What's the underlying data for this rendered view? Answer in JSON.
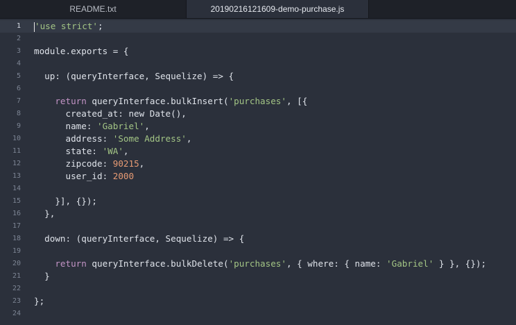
{
  "tabs": [
    {
      "label": "README.txt",
      "active": false
    },
    {
      "label": "20190216121609-demo-purchase.js",
      "active": true
    }
  ],
  "editor": {
    "current_line": 1,
    "lines": [
      {
        "num": "1",
        "tokens": [
          {
            "t": "'use strict'",
            "c": "str"
          },
          {
            "t": ";",
            "c": "plain"
          }
        ]
      },
      {
        "num": "2",
        "tokens": []
      },
      {
        "num": "3",
        "tokens": [
          {
            "t": "module.exports = {",
            "c": "plain"
          }
        ]
      },
      {
        "num": "4",
        "tokens": []
      },
      {
        "num": "5",
        "tokens": [
          {
            "t": "  up: (queryInterface, Sequelize) => {",
            "c": "plain"
          }
        ]
      },
      {
        "num": "6",
        "tokens": []
      },
      {
        "num": "7",
        "tokens": [
          {
            "t": "    ",
            "c": "plain"
          },
          {
            "t": "return",
            "c": "kw"
          },
          {
            "t": " queryInterface.bulkInsert(",
            "c": "plain"
          },
          {
            "t": "'purchases'",
            "c": "str"
          },
          {
            "t": ", [{",
            "c": "plain"
          }
        ]
      },
      {
        "num": "8",
        "tokens": [
          {
            "t": "      created_at: new Date(),",
            "c": "plain"
          }
        ]
      },
      {
        "num": "9",
        "tokens": [
          {
            "t": "      name: ",
            "c": "plain"
          },
          {
            "t": "'Gabriel'",
            "c": "str"
          },
          {
            "t": ",",
            "c": "plain"
          }
        ]
      },
      {
        "num": "10",
        "tokens": [
          {
            "t": "      address: ",
            "c": "plain"
          },
          {
            "t": "'Some Address'",
            "c": "str"
          },
          {
            "t": ",",
            "c": "plain"
          }
        ]
      },
      {
        "num": "11",
        "tokens": [
          {
            "t": "      state: ",
            "c": "plain"
          },
          {
            "t": "'WA'",
            "c": "str"
          },
          {
            "t": ",",
            "c": "plain"
          }
        ]
      },
      {
        "num": "12",
        "tokens": [
          {
            "t": "      zipcode: ",
            "c": "plain"
          },
          {
            "t": "90215",
            "c": "num"
          },
          {
            "t": ",",
            "c": "plain"
          }
        ]
      },
      {
        "num": "13",
        "tokens": [
          {
            "t": "      user_id: ",
            "c": "plain"
          },
          {
            "t": "2000",
            "c": "num"
          }
        ]
      },
      {
        "num": "14",
        "tokens": []
      },
      {
        "num": "15",
        "tokens": [
          {
            "t": "    }], {});",
            "c": "plain"
          }
        ]
      },
      {
        "num": "16",
        "tokens": [
          {
            "t": "  },",
            "c": "plain"
          }
        ]
      },
      {
        "num": "17",
        "tokens": []
      },
      {
        "num": "18",
        "tokens": [
          {
            "t": "  down: (queryInterface, Sequelize) => {",
            "c": "plain"
          }
        ]
      },
      {
        "num": "19",
        "tokens": []
      },
      {
        "num": "20",
        "tokens": [
          {
            "t": "    ",
            "c": "plain"
          },
          {
            "t": "return",
            "c": "kw"
          },
          {
            "t": " queryInterface.bulkDelete(",
            "c": "plain"
          },
          {
            "t": "'purchases'",
            "c": "str"
          },
          {
            "t": ", { where: { name: ",
            "c": "plain"
          },
          {
            "t": "'Gabriel'",
            "c": "str"
          },
          {
            "t": " } }, {});",
            "c": "plain"
          }
        ]
      },
      {
        "num": "21",
        "tokens": [
          {
            "t": "  }",
            "c": "plain"
          }
        ]
      },
      {
        "num": "22",
        "tokens": []
      },
      {
        "num": "23",
        "tokens": [
          {
            "t": "};",
            "c": "plain"
          }
        ]
      },
      {
        "num": "24",
        "tokens": []
      }
    ]
  },
  "colors": {
    "background": "#2b303b",
    "string": "#a3c585",
    "number": "#e79b74",
    "keyword": "#c394c6",
    "text": "#dfe3ea"
  }
}
